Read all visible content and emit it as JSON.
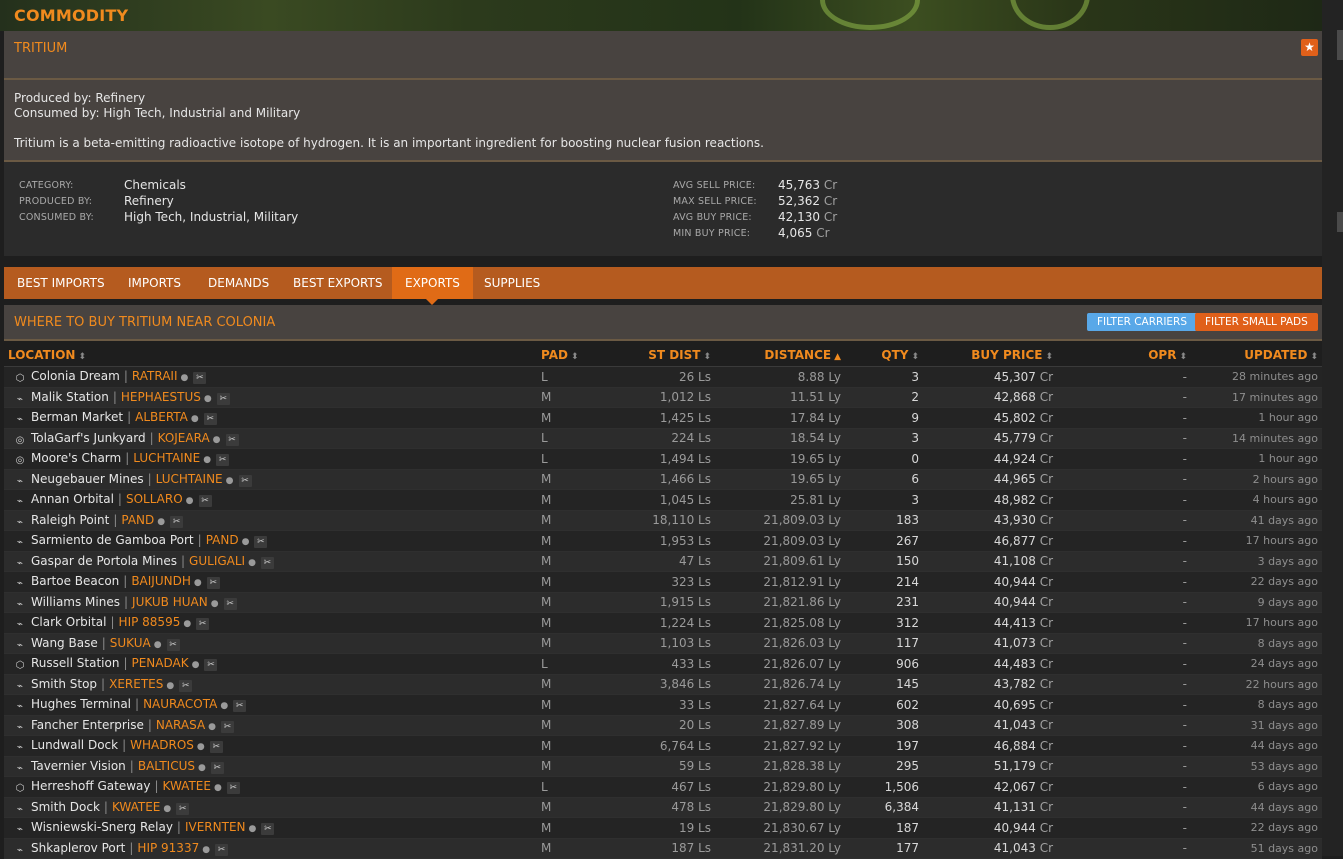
{
  "banner": {
    "title": "COMMODITY"
  },
  "commodity": {
    "name": "TRITIUM",
    "produced_line": "Produced by: Refinery",
    "consumed_line": "Consumed by: High Tech, Industrial and Military",
    "description": "Tritium is a beta-emitting radioactive isotope of hydrogen. It is an important ingredient for boosting nuclear fusion reactions."
  },
  "stats": {
    "category_label": "CATEGORY:",
    "category_value": "Chemicals",
    "produced_label": "PRODUCED BY:",
    "produced_value": "Refinery",
    "consumed_label": "CONSUMED BY:",
    "consumed_value": "High Tech, Industrial, Military",
    "avg_sell_label": "AVG SELL PRICE:",
    "avg_sell_value": "45,763",
    "max_sell_label": "MAX SELL PRICE:",
    "max_sell_value": "52,362",
    "avg_buy_label": "AVG BUY PRICE:",
    "avg_buy_value": "42,130",
    "min_buy_label": "MIN BUY PRICE:",
    "min_buy_value": "4,065",
    "currency": "Cr"
  },
  "tabs": [
    {
      "label": "BEST IMPORTS"
    },
    {
      "label": "IMPORTS"
    },
    {
      "label": "DEMANDS"
    },
    {
      "label": "BEST EXPORTS"
    },
    {
      "label": "EXPORTS",
      "active": true
    },
    {
      "label": "SUPPLIES"
    }
  ],
  "list": {
    "title": "WHERE TO BUY TRITIUM NEAR COLONIA",
    "filter_carriers": "FILTER CARRIERS",
    "filter_small_pads": "FILTER SMALL PADS"
  },
  "columns": {
    "location": "LOCATION",
    "pad": "PAD",
    "st_dist": "ST DIST",
    "distance": "DISTANCE",
    "qty": "QTY",
    "buy_price": "BUY PRICE",
    "opr": "OPR",
    "updated": "UPDATED"
  },
  "rows": [
    {
      "icon": "coriolis-icon",
      "station": "Colonia Dream",
      "system": "RATRAII",
      "pad": "L",
      "st_dist": "26 Ls",
      "distance": "8.88 Ly",
      "qty": "3",
      "price": "45,307",
      "opr": "-",
      "updated": "28 minutes ago"
    },
    {
      "icon": "outpost-icon",
      "station": "Malik Station",
      "system": "HEPHAESTUS",
      "pad": "M",
      "st_dist": "1,012 Ls",
      "distance": "11.51 Ly",
      "qty": "2",
      "price": "42,868",
      "opr": "-",
      "updated": "17 minutes ago"
    },
    {
      "icon": "outpost-icon",
      "station": "Berman Market",
      "system": "ALBERTA",
      "pad": "M",
      "st_dist": "1,425 Ls",
      "distance": "17.84 Ly",
      "qty": "9",
      "price": "45,802",
      "opr": "-",
      "updated": "1 hour ago"
    },
    {
      "icon": "ocellus-icon",
      "station": "TolaGarf's Junkyard",
      "system": "KOJEARA",
      "pad": "L",
      "st_dist": "224 Ls",
      "distance": "18.54 Ly",
      "qty": "3",
      "price": "45,779",
      "opr": "-",
      "updated": "14 minutes ago"
    },
    {
      "icon": "ocellus-icon",
      "station": "Moore's Charm",
      "system": "LUCHTAINE",
      "pad": "L",
      "st_dist": "1,494 Ls",
      "distance": "19.65 Ly",
      "qty": "0",
      "price": "44,924",
      "opr": "-",
      "updated": "1 hour ago"
    },
    {
      "icon": "outpost-icon",
      "station": "Neugebauer Mines",
      "system": "LUCHTAINE",
      "pad": "M",
      "st_dist": "1,466 Ls",
      "distance": "19.65 Ly",
      "qty": "6",
      "price": "44,965",
      "opr": "-",
      "updated": "2 hours ago"
    },
    {
      "icon": "outpost-icon",
      "station": "Annan Orbital",
      "system": "SOLLARO",
      "pad": "M",
      "st_dist": "1,045 Ls",
      "distance": "25.81 Ly",
      "qty": "3",
      "price": "48,982",
      "opr": "-",
      "updated": "4 hours ago"
    },
    {
      "icon": "outpost-icon",
      "station": "Raleigh Point",
      "system": "PAND",
      "pad": "M",
      "st_dist": "18,110 Ls",
      "distance": "21,809.03 Ly",
      "qty": "183",
      "price": "43,930",
      "opr": "-",
      "updated": "41 days ago"
    },
    {
      "icon": "outpost-icon",
      "station": "Sarmiento de Gamboa Port",
      "system": "PAND",
      "pad": "M",
      "st_dist": "1,953 Ls",
      "distance": "21,809.03 Ly",
      "qty": "267",
      "price": "46,877",
      "opr": "-",
      "updated": "17 hours ago"
    },
    {
      "icon": "outpost-icon",
      "station": "Gaspar de Portola Mines",
      "system": "GULIGALI",
      "pad": "M",
      "st_dist": "47 Ls",
      "distance": "21,809.61 Ly",
      "qty": "150",
      "price": "41,108",
      "opr": "-",
      "updated": "3 days ago"
    },
    {
      "icon": "outpost-icon",
      "station": "Bartoe Beacon",
      "system": "BAIJUNDH",
      "pad": "M",
      "st_dist": "323 Ls",
      "distance": "21,812.91 Ly",
      "qty": "214",
      "price": "40,944",
      "opr": "-",
      "updated": "22 days ago"
    },
    {
      "icon": "outpost-icon",
      "station": "Williams Mines",
      "system": "JUKUB HUAN",
      "pad": "M",
      "st_dist": "1,915 Ls",
      "distance": "21,821.86 Ly",
      "qty": "231",
      "price": "40,944",
      "opr": "-",
      "updated": "9 days ago"
    },
    {
      "icon": "outpost-icon",
      "station": "Clark Orbital",
      "system": "HIP 88595",
      "pad": "M",
      "st_dist": "1,224 Ls",
      "distance": "21,825.08 Ly",
      "qty": "312",
      "price": "44,413",
      "opr": "-",
      "updated": "17 hours ago"
    },
    {
      "icon": "outpost-icon",
      "station": "Wang Base",
      "system": "SUKUA",
      "pad": "M",
      "st_dist": "1,103 Ls",
      "distance": "21,826.03 Ly",
      "qty": "117",
      "price": "41,073",
      "opr": "-",
      "updated": "8 days ago"
    },
    {
      "icon": "coriolis-icon",
      "station": "Russell Station",
      "system": "PENADAK",
      "pad": "L",
      "st_dist": "433 Ls",
      "distance": "21,826.07 Ly",
      "qty": "906",
      "price": "44,483",
      "opr": "-",
      "updated": "24 days ago"
    },
    {
      "icon": "outpost-icon",
      "station": "Smith Stop",
      "system": "XERETES",
      "pad": "M",
      "st_dist": "3,846 Ls",
      "distance": "21,826.74 Ly",
      "qty": "145",
      "price": "43,782",
      "opr": "-",
      "updated": "22 hours ago"
    },
    {
      "icon": "outpost-icon",
      "station": "Hughes Terminal",
      "system": "NAURACOTA",
      "pad": "M",
      "st_dist": "33 Ls",
      "distance": "21,827.64 Ly",
      "qty": "602",
      "price": "40,695",
      "opr": "-",
      "updated": "8 days ago"
    },
    {
      "icon": "outpost-icon",
      "station": "Fancher Enterprise",
      "system": "NARASA",
      "pad": "M",
      "st_dist": "20 Ls",
      "distance": "21,827.89 Ly",
      "qty": "308",
      "price": "41,043",
      "opr": "-",
      "updated": "31 days ago"
    },
    {
      "icon": "outpost-icon",
      "station": "Lundwall Dock",
      "system": "WHADROS",
      "pad": "M",
      "st_dist": "6,764 Ls",
      "distance": "21,827.92 Ly",
      "qty": "197",
      "price": "46,884",
      "opr": "-",
      "updated": "44 days ago"
    },
    {
      "icon": "outpost-icon",
      "station": "Tavernier Vision",
      "system": "BALTICUS",
      "pad": "M",
      "st_dist": "59 Ls",
      "distance": "21,828.38 Ly",
      "qty": "295",
      "price": "51,179",
      "opr": "-",
      "updated": "53 days ago"
    },
    {
      "icon": "coriolis-icon",
      "station": "Herreshoff Gateway",
      "system": "KWATEE",
      "pad": "L",
      "st_dist": "467 Ls",
      "distance": "21,829.80 Ly",
      "qty": "1,506",
      "price": "42,067",
      "opr": "-",
      "updated": "6 days ago"
    },
    {
      "icon": "outpost-icon",
      "station": "Smith Dock",
      "system": "KWATEE",
      "pad": "M",
      "st_dist": "478 Ls",
      "distance": "21,829.80 Ly",
      "qty": "6,384",
      "price": "41,131",
      "opr": "-",
      "updated": "44 days ago"
    },
    {
      "icon": "outpost-icon",
      "station": "Wisniewski-Snerg Relay",
      "system": "IVERNTEN",
      "pad": "M",
      "st_dist": "19 Ls",
      "distance": "21,830.67 Ly",
      "qty": "187",
      "price": "40,944",
      "opr": "-",
      "updated": "22 days ago"
    },
    {
      "icon": "outpost-icon",
      "station": "Shkaplerov Port",
      "system": "HIP 91337",
      "pad": "M",
      "st_dist": "187 Ls",
      "distance": "21,831.20 Ly",
      "qty": "177",
      "price": "41,043",
      "opr": "-",
      "updated": "51 days ago"
    }
  ]
}
